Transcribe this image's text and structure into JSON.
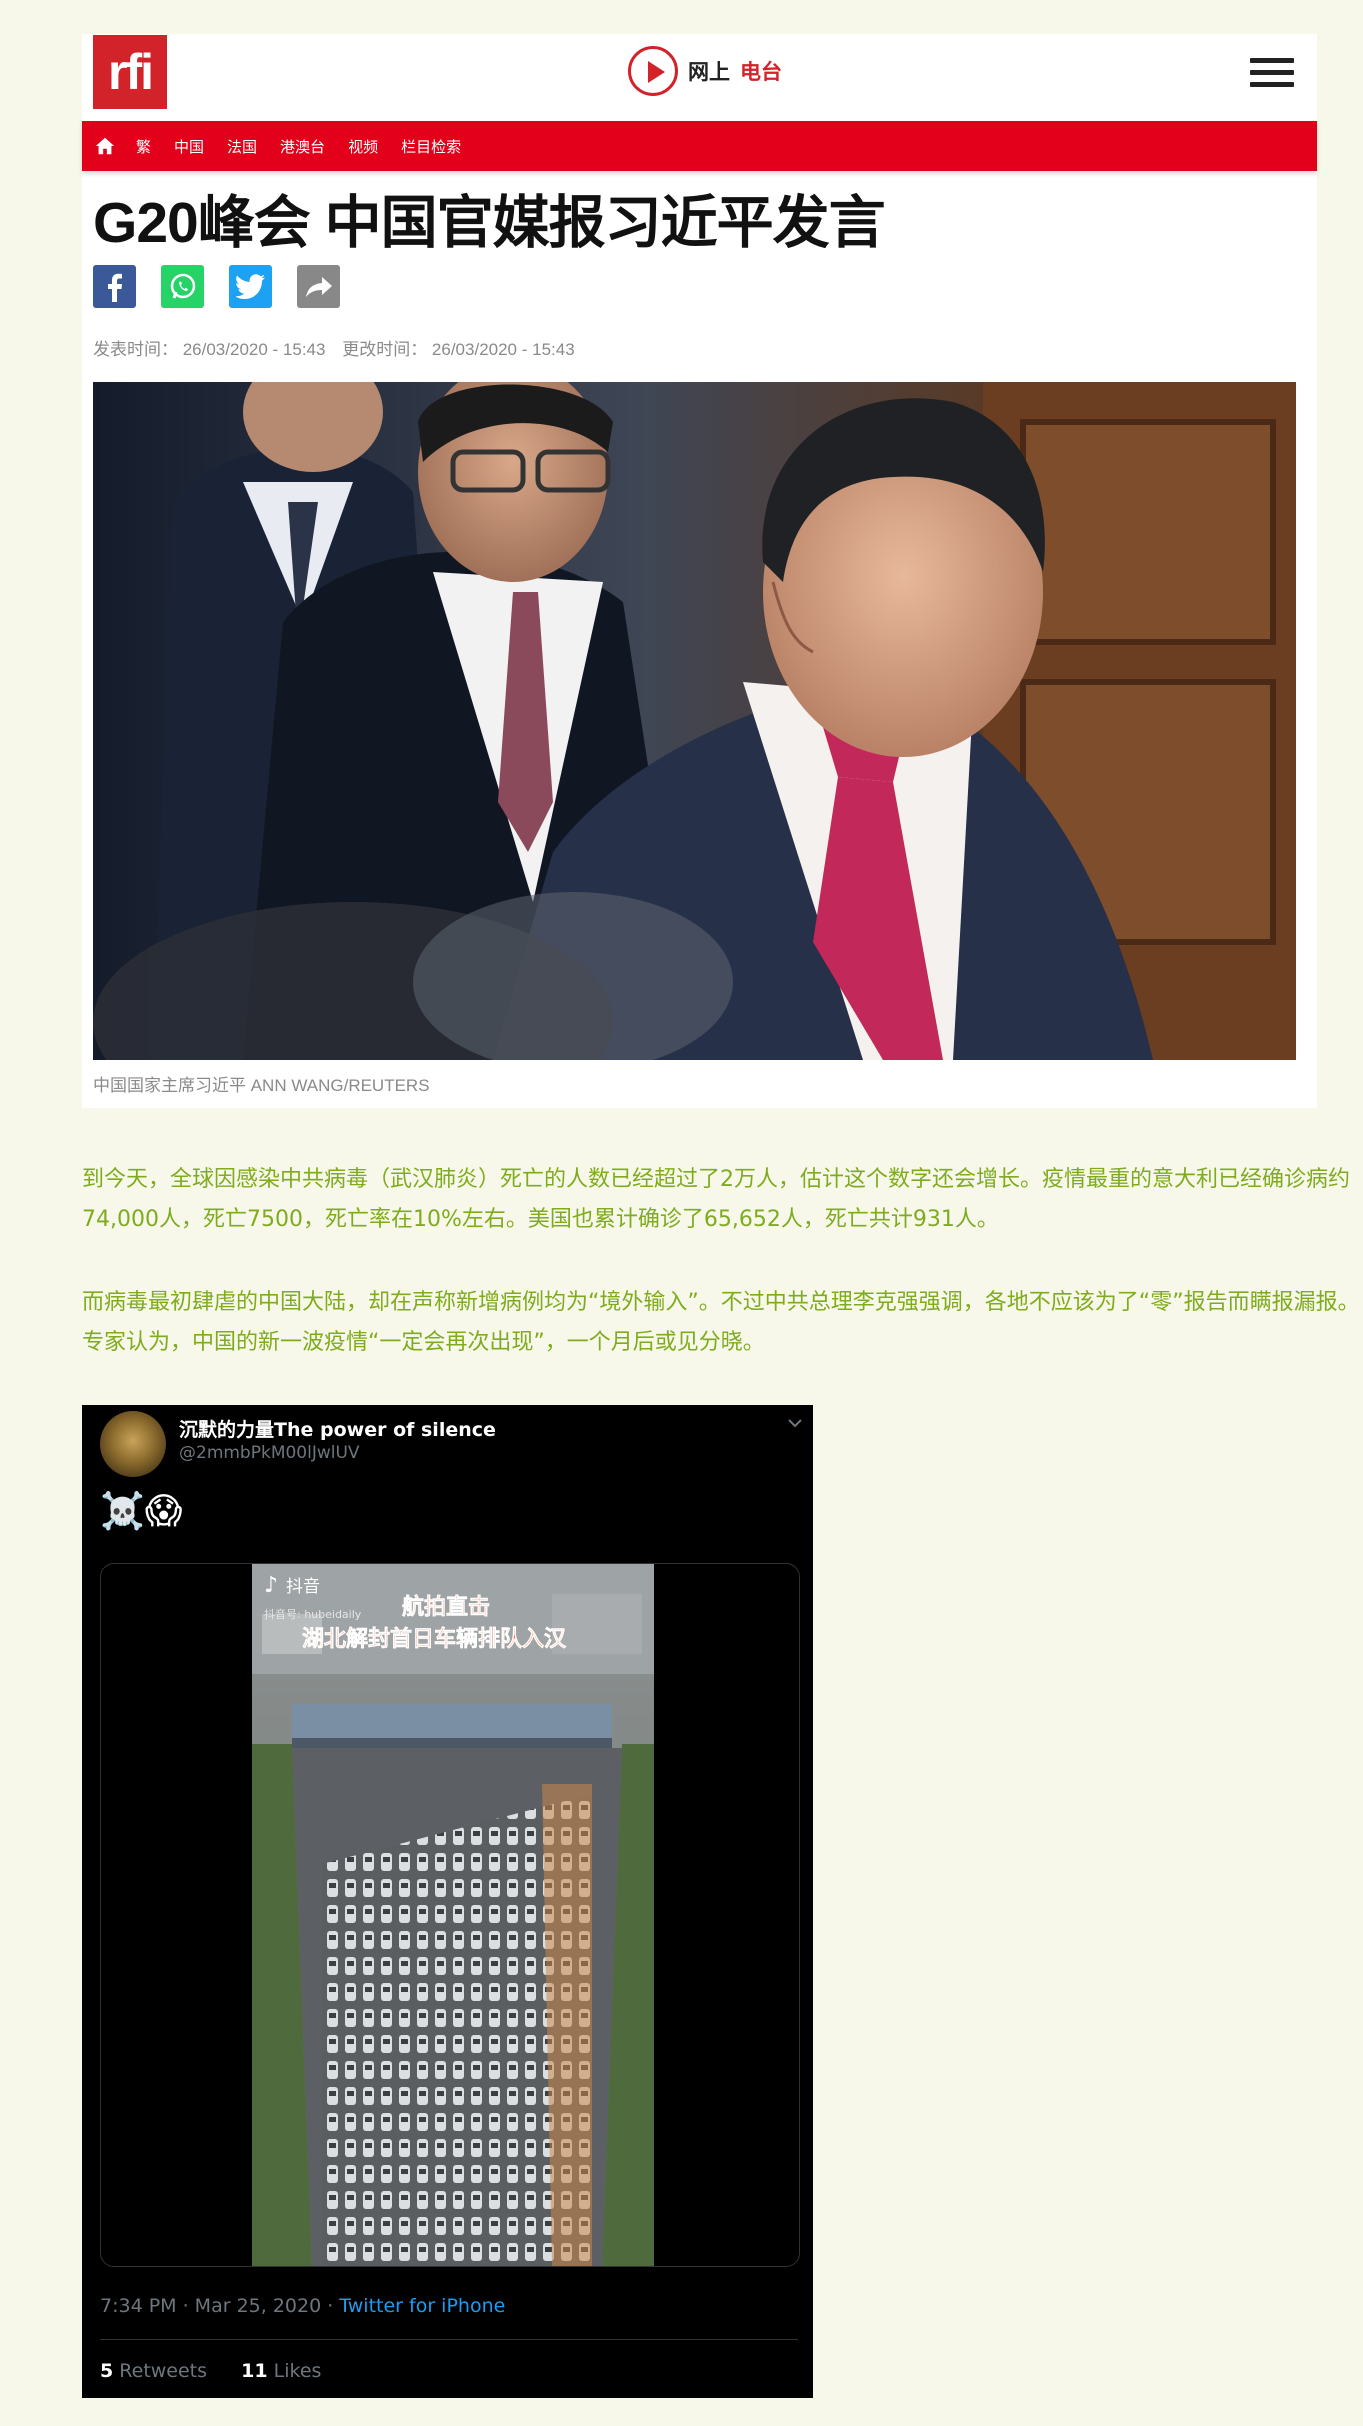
{
  "header": {
    "logo_text": "rfi",
    "radio_label_a": "网上",
    "radio_label_b": "电台"
  },
  "nav": {
    "items": [
      "繁",
      "中国",
      "法国",
      "港澳台",
      "视频",
      "栏目检索"
    ]
  },
  "article": {
    "title": "G20峰会 中国官媒报习近平发言",
    "published": "发表时间： 26/03/2020 - 15:43",
    "modified": "更改时间： 26/03/2020 - 15:43",
    "caption": "中国国家主席习近平 ANN WANG/REUTERS"
  },
  "body": {
    "paragraph1": "到今天，全球因感染中共病毒（武汉肺炎）死亡的人数已经超过了2万人，估计这个数字还会增长。疫情最重的意大利已经确诊病约74,000人，死亡7500，死亡率在10%左右。美国也累计确诊了65,652人，死亡共计931人。",
    "paragraph2": "而病毒最初肆虐的中国大陆，却在声称新增病例均为“境外输入”。不过中共总理李克强强调，各地不应该为了“零”报告而瞒报漏报。专家认为，中国的新一波疫情“一定会再次出现”，一个月后或见分晓。"
  },
  "tweet": {
    "name": "沉默的力量The power of silence",
    "handle": "@2mmbPkM00lJwlUV",
    "emoji": "☠️😱",
    "video_brand": "抖音",
    "video_account": "抖音号: hubeidaily",
    "video_title_1": "航拍直击",
    "video_title_2": "湖北解封首日车辆排队入汉",
    "time": "7:34 PM · Mar 25, 2020 · ",
    "source": "Twitter for iPhone",
    "retweets_count": "5",
    "retweets_label": "Retweets",
    "likes_count": "11",
    "likes_label": "Likes"
  },
  "colors": {
    "brand_red": "#e2001a",
    "paragraph_green": "#7fac1e",
    "twitter_blue": "#1d9bf0",
    "facebook": "#3b5998",
    "whatsapp": "#25d366",
    "twitter_share": "#1da1f2",
    "share_grey": "#888888"
  }
}
